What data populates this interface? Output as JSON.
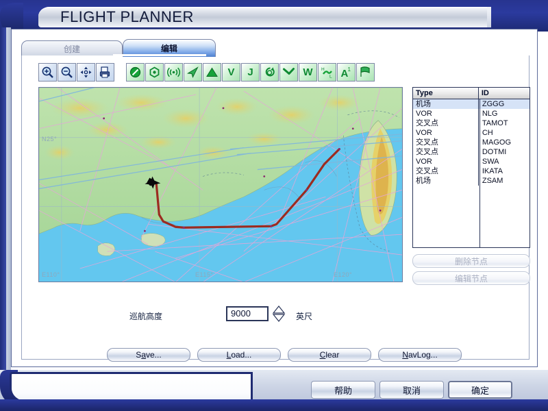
{
  "window": {
    "title": "FLIGHT PLANNER"
  },
  "tabs": [
    {
      "id": "create",
      "label": "创建",
      "active": false
    },
    {
      "id": "edit",
      "label": "编辑",
      "active": true
    }
  ],
  "toolbar": {
    "groups": [
      {
        "name": "view-tools",
        "buttons": [
          {
            "icon": "zoom-in-icon",
            "glyph": "⊕",
            "tone": "blue"
          },
          {
            "icon": "zoom-out-icon",
            "glyph": "⊖",
            "tone": "blue"
          },
          {
            "icon": "pan-icon",
            "glyph": "✥",
            "tone": "blue"
          },
          {
            "icon": "print-icon",
            "glyph": "⎙",
            "tone": "blue"
          }
        ]
      },
      {
        "name": "layer-tools",
        "buttons": [
          {
            "icon": "airport-icon",
            "glyph": "⊘",
            "tone": "green"
          },
          {
            "icon": "vor-icon",
            "glyph": "⬡",
            "tone": "green"
          },
          {
            "icon": "ndb-icon",
            "glyph": "((•))",
            "tone": "green"
          },
          {
            "icon": "aircraft-icon",
            "glyph": "➤",
            "tone": "green"
          },
          {
            "icon": "terrain-icon",
            "glyph": "▲",
            "tone": "green"
          },
          {
            "icon": "victor-airway-icon",
            "glyph": "V",
            "tone": "green"
          },
          {
            "icon": "jet-airway-icon",
            "glyph": "J",
            "tone": "green"
          },
          {
            "icon": "holding-pattern-icon",
            "glyph": "↻",
            "tone": "green"
          },
          {
            "icon": "route-leg-icon",
            "glyph": "⤵",
            "tone": "green"
          },
          {
            "icon": "weather-icon",
            "glyph": "W",
            "tone": "green"
          },
          {
            "icon": "pressure-hl-icon",
            "glyph": "HL",
            "tone": "green"
          },
          {
            "icon": "labels-icon",
            "glyph": "A¹",
            "tone": "green"
          },
          {
            "icon": "flag-icon",
            "glyph": "⚑",
            "tone": "green"
          }
        ]
      }
    ]
  },
  "map": {
    "longitude_labels": [
      "E110°",
      "E115°",
      "E120°"
    ],
    "latitude_labels": [
      "N25°"
    ],
    "route_color": "#9c2b20",
    "water_color": "#63c7ef",
    "land_color": "#b9dfa8",
    "highland_color": "#e8cf62",
    "airway_color": "#e4a6d8"
  },
  "node_list": {
    "columns": [
      "Type",
      "ID"
    ],
    "rows": [
      {
        "type": "机场",
        "id": "ZGGG",
        "selected": true
      },
      {
        "type": "VOR",
        "id": "NLG",
        "selected": false
      },
      {
        "type": "交叉点",
        "id": "TAMOT",
        "selected": false
      },
      {
        "type": "VOR",
        "id": "CH",
        "selected": false
      },
      {
        "type": "交叉点",
        "id": "MAGOG",
        "selected": false
      },
      {
        "type": "交叉点",
        "id": "DOTMI",
        "selected": false
      },
      {
        "type": "VOR",
        "id": "SWA",
        "selected": false
      },
      {
        "type": "交叉点",
        "id": "IKATA",
        "selected": false
      },
      {
        "type": "机场",
        "id": "ZSAM",
        "selected": false
      }
    ]
  },
  "side_buttons": [
    {
      "name": "delete-node",
      "label": "删除节点",
      "enabled": false
    },
    {
      "name": "edit-node",
      "label": "编辑节点",
      "enabled": false
    }
  ],
  "altitude": {
    "label": "巡航高度",
    "value": "9000",
    "unit": "英尺"
  },
  "actions": [
    {
      "name": "save",
      "pre": "S",
      "accel": "a",
      "post": "ve..."
    },
    {
      "name": "load",
      "pre": "",
      "accel": "L",
      "post": "oad..."
    },
    {
      "name": "clear",
      "pre": "",
      "accel": "C",
      "post": "lear"
    },
    {
      "name": "navlog",
      "pre": "",
      "accel": "N",
      "post": "avLog..."
    }
  ],
  "dialog_buttons": [
    {
      "name": "help",
      "label": "帮助",
      "default": false
    },
    {
      "name": "cancel",
      "label": "取消",
      "default": false
    },
    {
      "name": "ok",
      "label": "确定",
      "default": true
    }
  ],
  "status_bar": {
    "text": ""
  }
}
